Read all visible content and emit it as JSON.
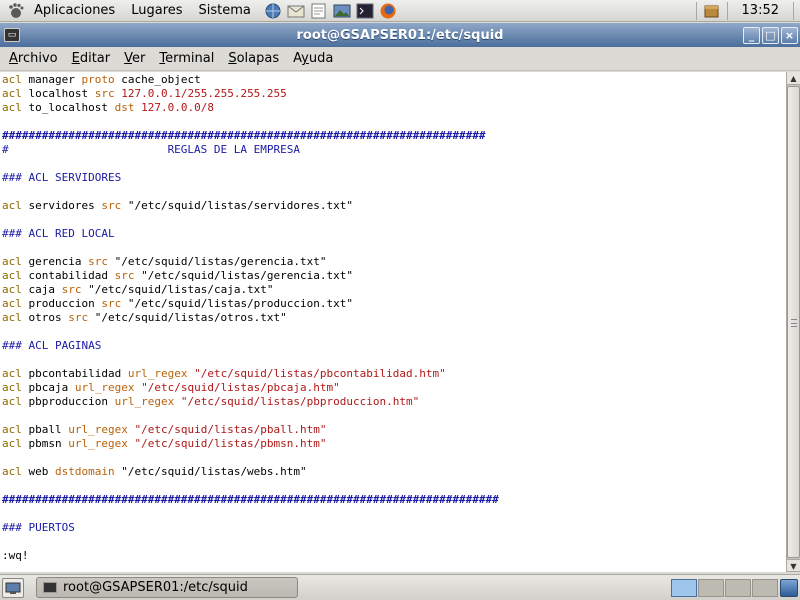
{
  "top_panel": {
    "menus": [
      "Aplicaciones",
      "Lugares",
      "Sistema"
    ],
    "launchers": [
      "network-icon",
      "mail-icon",
      "text-editor-icon",
      "image-viewer-icon",
      "terminal-launcher-icon",
      "firefox-icon"
    ],
    "clock": "13:52"
  },
  "window": {
    "title": "root@GSAPSER01:/etc/squid",
    "menu": [
      "Archivo",
      "Editar",
      "Ver",
      "Terminal",
      "Solapas",
      "Ayuda"
    ],
    "menu_mnemonic_index": [
      0,
      0,
      0,
      0,
      0,
      1
    ]
  },
  "terminal_lines": [
    [
      [
        "acl",
        "kw"
      ],
      [
        " manager ",
        ""
      ],
      [
        "proto",
        "k2"
      ],
      [
        " cache_object",
        ""
      ]
    ],
    [
      [
        "acl",
        "kw"
      ],
      [
        " localhost ",
        ""
      ],
      [
        "src",
        "k2"
      ],
      [
        " ",
        ""
      ],
      [
        "127.0.0.1/255.255.255.255",
        "num"
      ]
    ],
    [
      [
        "acl",
        "kw"
      ],
      [
        " to_localhost ",
        ""
      ],
      [
        "dst",
        "k2"
      ],
      [
        " ",
        ""
      ],
      [
        "127.0.0.0/8",
        "num"
      ]
    ],
    [],
    [
      [
        "#########################################################################",
        "hash"
      ]
    ],
    [
      [
        "#                        REGLAS DE LA EMPRESA",
        "cm"
      ]
    ],
    [],
    [
      [
        "### ACL SERVIDORES",
        "cm"
      ]
    ],
    [],
    [
      [
        "acl",
        "kw"
      ],
      [
        " servidores ",
        ""
      ],
      [
        "src",
        "k2"
      ],
      [
        " \"/etc/squid/listas/servidores.txt\"",
        ""
      ]
    ],
    [],
    [
      [
        "### ACL RED LOCAL",
        "cm"
      ]
    ],
    [],
    [
      [
        "acl",
        "kw"
      ],
      [
        " gerencia ",
        ""
      ],
      [
        "src",
        "k2"
      ],
      [
        " \"/etc/squid/listas/gerencia.txt\"",
        ""
      ]
    ],
    [
      [
        "acl",
        "kw"
      ],
      [
        " contabilidad ",
        ""
      ],
      [
        "src",
        "k2"
      ],
      [
        " \"/etc/squid/listas/gerencia.txt\"",
        ""
      ]
    ],
    [
      [
        "acl",
        "kw"
      ],
      [
        " caja ",
        ""
      ],
      [
        "src",
        "k2"
      ],
      [
        " \"/etc/squid/listas/caja.txt\"",
        ""
      ]
    ],
    [
      [
        "acl",
        "kw"
      ],
      [
        " produccion ",
        ""
      ],
      [
        "src",
        "k2"
      ],
      [
        " \"/etc/squid/listas/produccion.txt\"",
        ""
      ]
    ],
    [
      [
        "acl",
        "kw"
      ],
      [
        " otros ",
        ""
      ],
      [
        "src",
        "k2"
      ],
      [
        " \"/etc/squid/listas/otros.txt\"",
        ""
      ]
    ],
    [],
    [
      [
        "### ACL PAGINAS",
        "cm"
      ]
    ],
    [],
    [
      [
        "acl",
        "kw"
      ],
      [
        " pbcontabilidad ",
        ""
      ],
      [
        "url_regex",
        "k2"
      ],
      [
        " ",
        ""
      ],
      [
        "\"/etc/squid/listas/pbcontabilidad.htm\"",
        "str"
      ]
    ],
    [
      [
        "acl",
        "kw"
      ],
      [
        " pbcaja ",
        ""
      ],
      [
        "url_regex",
        "k2"
      ],
      [
        " ",
        ""
      ],
      [
        "\"/etc/squid/listas/pbcaja.htm\"",
        "str"
      ]
    ],
    [
      [
        "acl",
        "kw"
      ],
      [
        " pbproduccion ",
        ""
      ],
      [
        "url_regex",
        "k2"
      ],
      [
        " ",
        ""
      ],
      [
        "\"/etc/squid/listas/pbproduccion.htm\"",
        "str"
      ]
    ],
    [],
    [
      [
        "acl",
        "kw"
      ],
      [
        " pball ",
        ""
      ],
      [
        "url_regex",
        "k2"
      ],
      [
        " ",
        ""
      ],
      [
        "\"/etc/squid/listas/pball.htm\"",
        "str"
      ]
    ],
    [
      [
        "acl",
        "kw"
      ],
      [
        " pbmsn ",
        ""
      ],
      [
        "url_regex",
        "k2"
      ],
      [
        " ",
        ""
      ],
      [
        "\"/etc/squid/listas/pbmsn.htm\"",
        "str"
      ]
    ],
    [],
    [
      [
        "acl",
        "kw"
      ],
      [
        " web ",
        ""
      ],
      [
        "dstdomain",
        "k2"
      ],
      [
        " \"/etc/squid/listas/webs.htm\"",
        ""
      ]
    ],
    [],
    [
      [
        "###########################################################################",
        "hash"
      ]
    ],
    [],
    [
      [
        "### PUERTOS",
        "cm"
      ]
    ],
    [],
    [
      [
        ":wq!",
        ""
      ]
    ]
  ],
  "bottom_panel": {
    "task_label": "root@GSAPSER01:/etc/squid",
    "workspace_count": 4,
    "active_workspace": 0
  },
  "colors": {
    "titlebar": "#4b6e9b",
    "keyword": "#8a6a00",
    "directive": "#b8620a",
    "string": "#b01818",
    "comment": "#1a1aa6"
  }
}
